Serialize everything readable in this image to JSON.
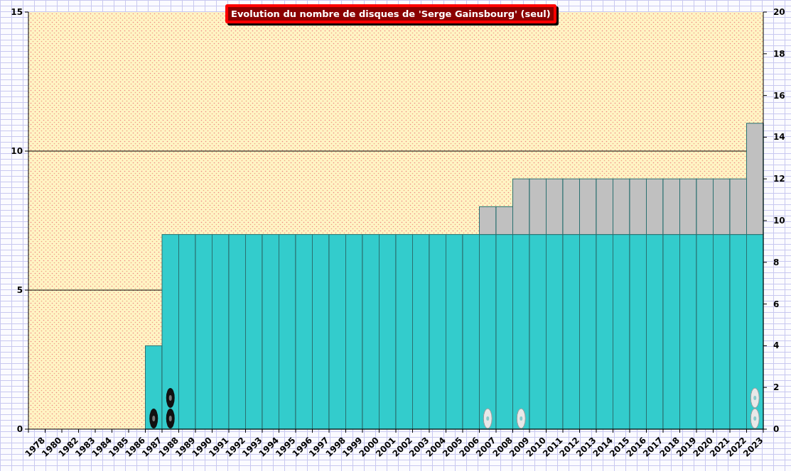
{
  "chart": {
    "title": "Evolution du nombre de disques de 'Serge Gainsbourg' (seul)",
    "chart_data": {
      "type": "bar",
      "stacked": true,
      "categories": [
        "1978",
        "1980",
        "1982",
        "1983",
        "1984",
        "1985",
        "1986",
        "1987",
        "1988",
        "1989",
        "1990",
        "1991",
        "1992",
        "1993",
        "1994",
        "1995",
        "1996",
        "1997",
        "1998",
        "1999",
        "2000",
        "2001",
        "2002",
        "2003",
        "2004",
        "2005",
        "2006",
        "2007",
        "2008",
        "2009",
        "2010",
        "2011",
        "2012",
        "2013",
        "2014",
        "2015",
        "2016",
        "2017",
        "2018",
        "2019",
        "2020",
        "2021",
        "2022",
        "2023"
      ],
      "series": [
        {
          "color": "#33cccc",
          "values": [
            0,
            0,
            0,
            0,
            0,
            0,
            0,
            3,
            7,
            7,
            7,
            7,
            7,
            7,
            7,
            7,
            7,
            7,
            7,
            7,
            7,
            7,
            7,
            7,
            7,
            7,
            7,
            7,
            7,
            7,
            7,
            7,
            7,
            7,
            7,
            7,
            7,
            7,
            7,
            7,
            7,
            7,
            7,
            7
          ]
        },
        {
          "color": "#c0c0c0",
          "values": [
            0,
            0,
            0,
            0,
            0,
            0,
            0,
            0,
            0,
            0,
            0,
            0,
            0,
            0,
            0,
            0,
            0,
            0,
            0,
            0,
            0,
            0,
            0,
            0,
            0,
            0,
            0,
            1,
            1,
            2,
            2,
            2,
            2,
            2,
            2,
            2,
            2,
            2,
            2,
            2,
            2,
            2,
            2,
            4
          ]
        }
      ],
      "ylim": [
        0,
        15
      ],
      "yticks": [
        0,
        5,
        10,
        15
      ],
      "y2lim": [
        0,
        20
      ],
      "y2ticks": [
        0,
        2,
        4,
        6,
        8,
        10,
        12,
        14,
        16,
        18,
        20
      ]
    },
    "disc_columns": [
      {
        "kind": "none"
      },
      {
        "kind": "none"
      },
      {
        "kind": "none"
      },
      {
        "kind": "none"
      },
      {
        "kind": "none"
      },
      {
        "kind": "none"
      },
      {
        "kind": "none"
      },
      {
        "kind": "black-disc"
      },
      {
        "kind": "black-pair"
      },
      {
        "kind": "none"
      },
      {
        "kind": "none"
      },
      {
        "kind": "none"
      },
      {
        "kind": "none"
      },
      {
        "kind": "none"
      },
      {
        "kind": "none"
      },
      {
        "kind": "none"
      },
      {
        "kind": "none"
      },
      {
        "kind": "none"
      },
      {
        "kind": "none"
      },
      {
        "kind": "none"
      },
      {
        "kind": "none"
      },
      {
        "kind": "none"
      },
      {
        "kind": "none"
      },
      {
        "kind": "none"
      },
      {
        "kind": "none"
      },
      {
        "kind": "none"
      },
      {
        "kind": "none"
      },
      {
        "kind": "silver-disc"
      },
      {
        "kind": "none"
      },
      {
        "kind": "silver-disc"
      },
      {
        "kind": "none"
      },
      {
        "kind": "none"
      },
      {
        "kind": "none"
      },
      {
        "kind": "none"
      },
      {
        "kind": "none"
      },
      {
        "kind": "none"
      },
      {
        "kind": "none"
      },
      {
        "kind": "none"
      },
      {
        "kind": "none"
      },
      {
        "kind": "none"
      },
      {
        "kind": "none"
      },
      {
        "kind": "none"
      },
      {
        "kind": "none"
      },
      {
        "kind": "silver-pair"
      }
    ]
  }
}
